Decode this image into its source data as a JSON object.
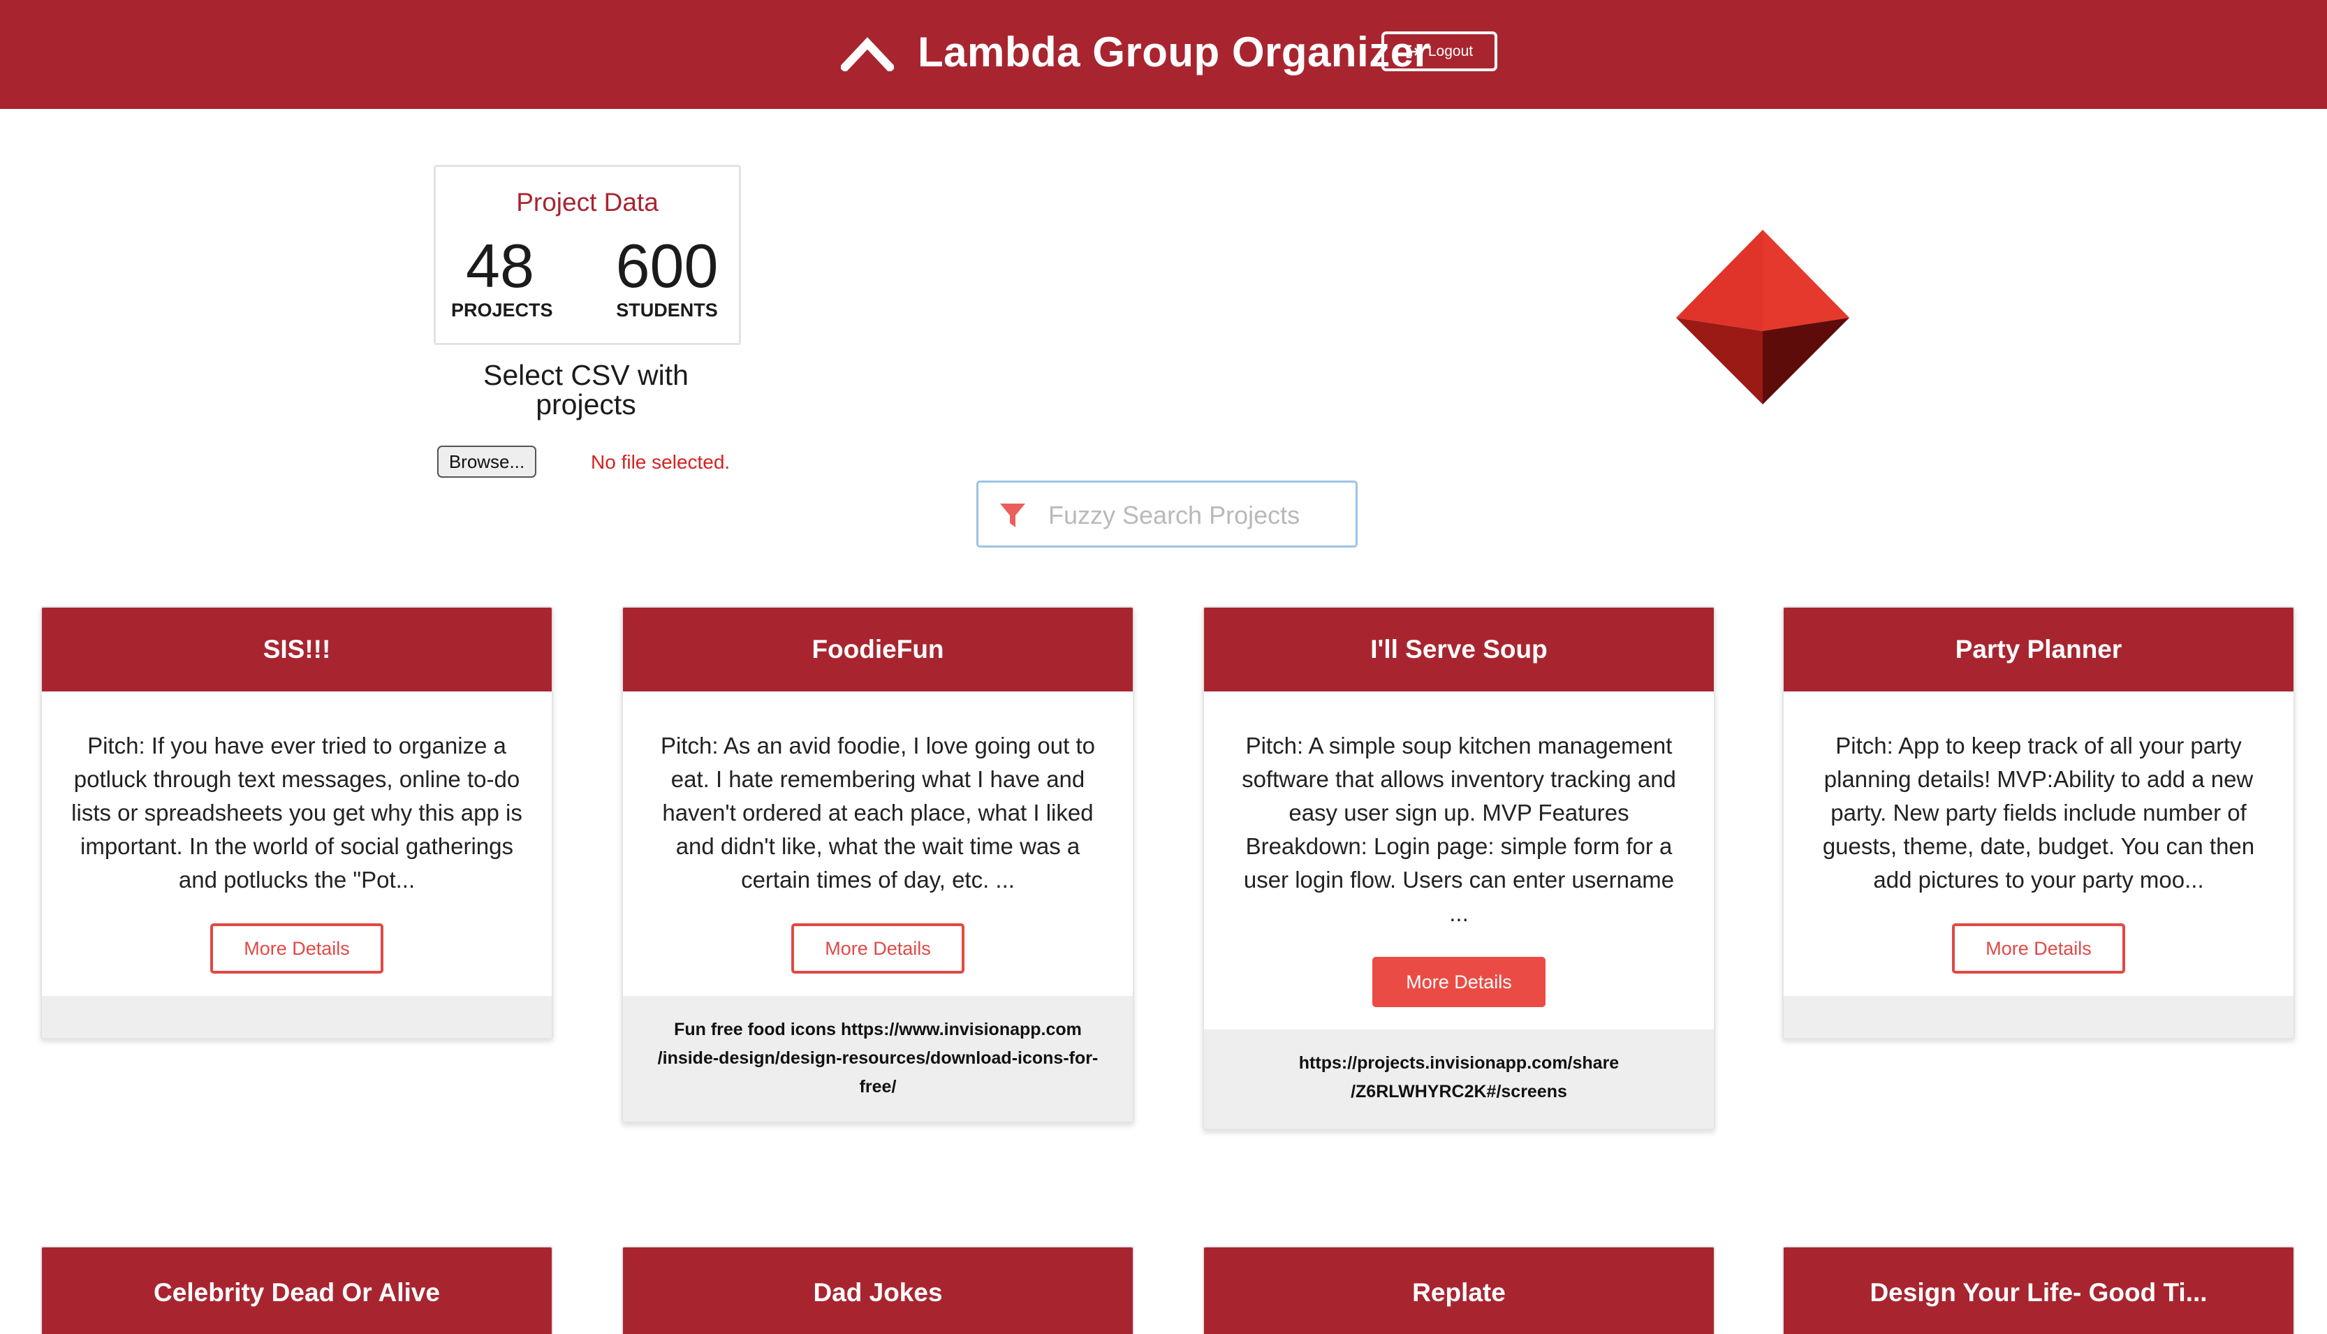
{
  "header": {
    "title": "Lambda Group Organizer",
    "logout_label": "Logout",
    "color": "#a82530"
  },
  "project_data": {
    "title": "Project Data",
    "projects_count": "48",
    "projects_label": "PROJECTS",
    "students_count": "600",
    "students_label": "STUDENTS"
  },
  "csv": {
    "label": "Select CSV with projects",
    "browse_label": "Browse...",
    "status": "No file selected."
  },
  "search": {
    "placeholder": "Fuzzy Search Projects"
  },
  "cards": [
    {
      "title": "SIS!!!",
      "pitch": "Pitch: If you have ever tried to organize a potluck through text messages, online to-do lists or spreadsheets you get why this app is important. In the world of social gatherings and potlucks the \"Pot...",
      "button": "More Details",
      "footer": ""
    },
    {
      "title": "FoodieFun",
      "pitch": "Pitch: As an avid foodie, I love going out to eat. I hate remembering what I have and haven't ordered at each place, what I liked and didn't like, what the wait time was a certain times of day, etc. ...",
      "button": "More Details",
      "footer": "Fun free food icons https://www.invisionapp.com /inside-design/design-resources/download-icons-for-free/"
    },
    {
      "title": "I'll Serve Soup",
      "pitch": "Pitch: A simple soup kitchen management software that allows inventory tracking and easy user sign up. MVP Features Breakdown: Login page: simple form for a user login flow. Users can enter username ...",
      "button": "More Details",
      "footer": "https://projects.invisionapp.com/share /Z6RLWHYRC2K#/screens"
    },
    {
      "title": "Party Planner",
      "pitch": "Pitch: App to keep track of all your party planning details! MVP:Ability to add a new party. New party fields include number of guests, theme, date, budget. You can then add pictures to your party moo...",
      "button": "More Details",
      "footer": ""
    }
  ],
  "cards_row2": [
    {
      "title": "Celebrity Dead Or Alive"
    },
    {
      "title": "Dad Jokes"
    },
    {
      "title": "Replate"
    },
    {
      "title": "Design Your Life- Good Ti..."
    }
  ]
}
